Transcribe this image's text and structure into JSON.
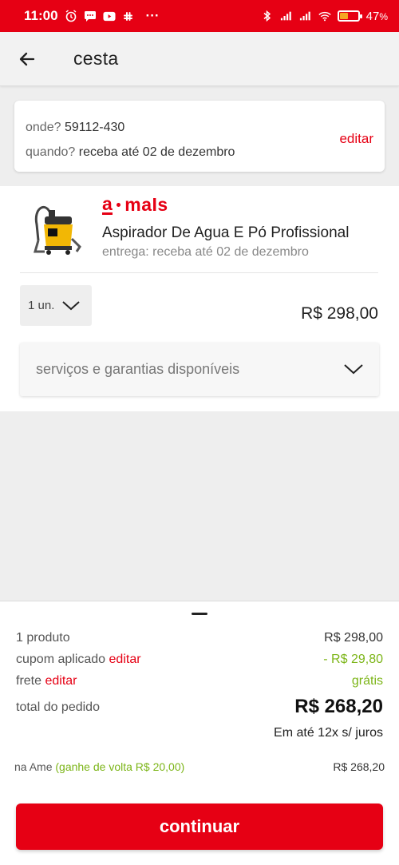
{
  "status_bar": {
    "time": "11:00",
    "dots": "···",
    "battery_pct": "47",
    "battery_suffix": "%"
  },
  "header": {
    "title": "cesta"
  },
  "delivery": {
    "where_label": "onde?",
    "where_value": "59112-430",
    "when_label": "quando?",
    "when_value": "receba até 02 de dezembro",
    "edit_label": "editar"
  },
  "product": {
    "seller": {
      "a": "a",
      "rest": "maIs"
    },
    "name": "Aspirador De Agua E Pó Profissional",
    "delivery_text": "entrega: receba até 02 de dezembro",
    "quantity": "1 un.",
    "price": "R$ 298,00",
    "services_label": "serviços e garantias disponíveis"
  },
  "summary": {
    "products_label": "1 produto",
    "products_value": "R$ 298,00",
    "coupon_label": "cupom aplicado",
    "coupon_edit": "editar",
    "coupon_value": "- R$ 29,80",
    "shipping_label": "frete",
    "shipping_edit": "editar",
    "shipping_value": "grátis",
    "total_label": "total do pedido",
    "total_value": "R$ 268,20",
    "installments": "Em até 12x s/ juros",
    "ame_label": "na Ame",
    "ame_cashback": "(ganhe de volta R$ 20,00)",
    "ame_value": "R$ 268,20"
  },
  "actions": {
    "continue_label": "continuar"
  },
  "colors": {
    "brand_red": "#e60014",
    "discount_green": "#7cb518"
  },
  "icons": {
    "back": "arrow-left-icon",
    "chevron": "chevron-down-icon"
  }
}
